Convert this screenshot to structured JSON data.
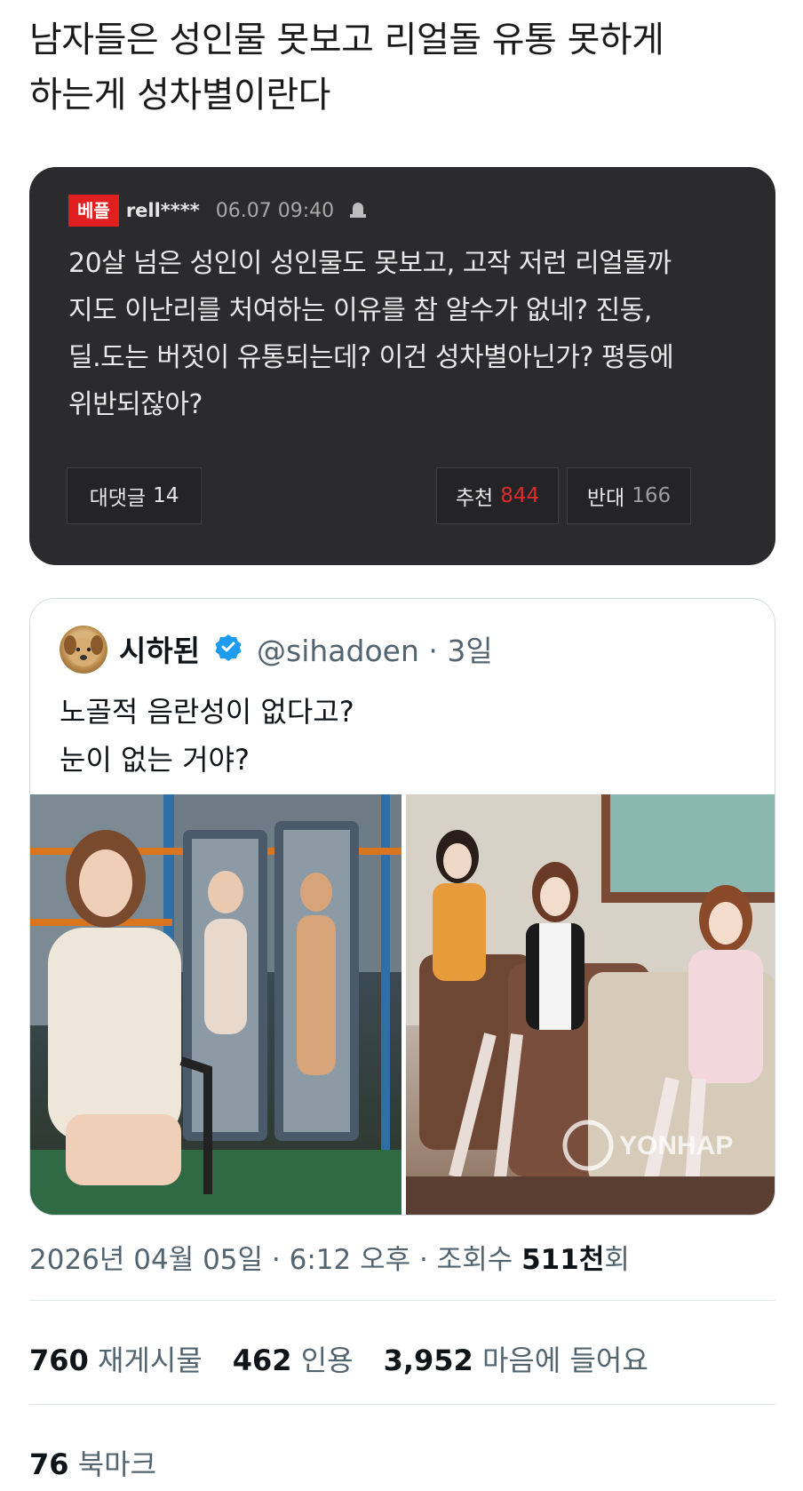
{
  "post_title_lines": [
    "남자들은 성인물 못보고 리얼돌 유통 못하게",
    "하는게 성차별이란다"
  ],
  "comment_card": {
    "badge": "베플",
    "username": "rell****",
    "datetime": "06.07 09:40",
    "text_lines": [
      "20살 넘은 성인이 성인물도 못보고, 고작 저런 리얼돌까",
      "지도 이난리를 처여하는 이유를 참 알수가 없네? 진동,",
      "딜.도는 버젓이 유통되는데? 이건 성차별아닌가? 평등에",
      "위반되잖아?"
    ],
    "reply_label": "대댓글",
    "reply_count": "14",
    "like_label": "추천",
    "like_count": "844",
    "dislike_label": "반대",
    "dislike_count": "166"
  },
  "tweet": {
    "display_name": "시하된",
    "handle_time": "@sihadoen · 3일",
    "text_lines": [
      "노골적 음란성이 없다고?",
      "눈이 없는 거야?"
    ],
    "watermark": "YONHAP"
  },
  "footer": {
    "timestamp": "2026년 04월 05일 · 6:12 오후 · 조회수 ",
    "views_num": "511천",
    "views_suffix": "회",
    "reposts_num": "760",
    "reposts_label": "재게시물",
    "quotes_num": "462",
    "quotes_label": "인용",
    "likes_num": "3,952",
    "likes_label": "마음에 들어요",
    "bookmarks_num": "76",
    "bookmarks_label": "북마크"
  },
  "colors": {
    "dark_card_bg": "#2b2b2d",
    "best_badge": "#e02020",
    "like_count": "#e02a2a",
    "verified_blue": "#1d9bf0"
  }
}
